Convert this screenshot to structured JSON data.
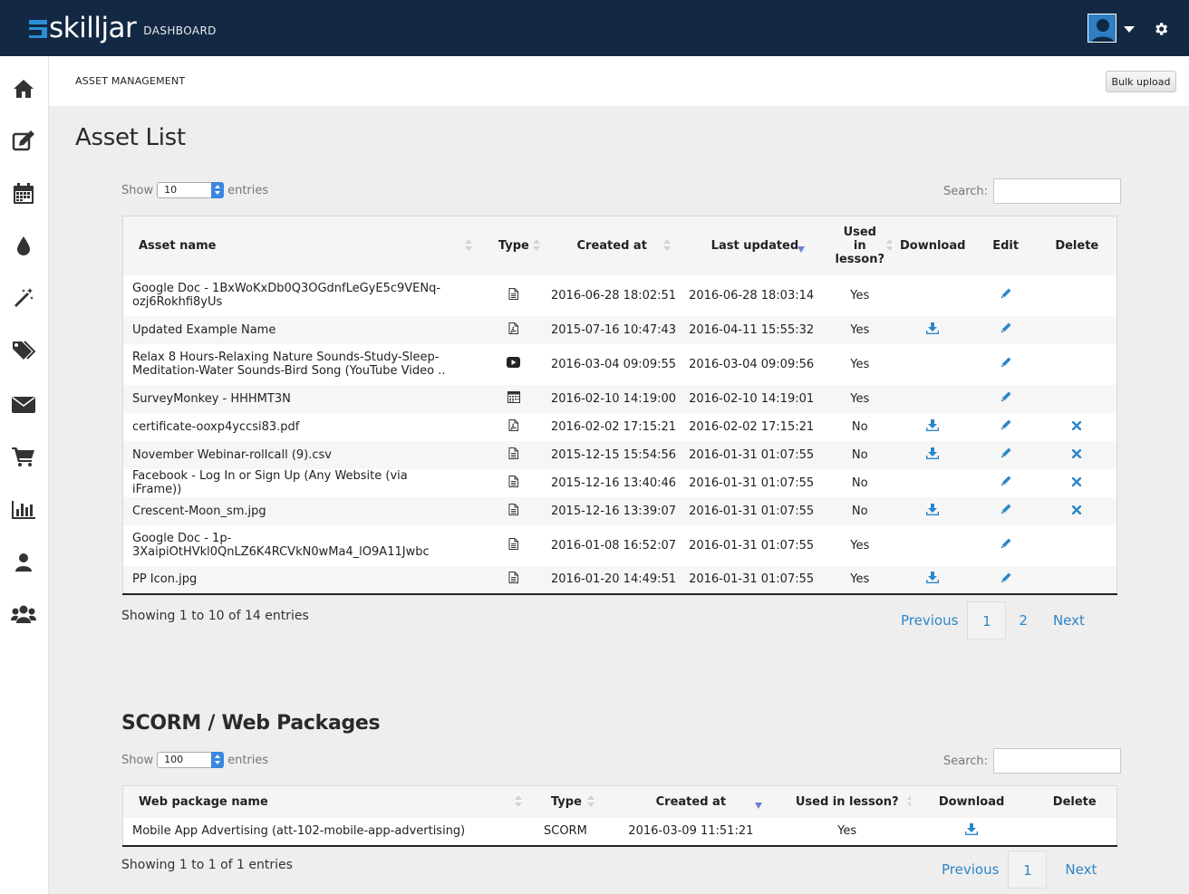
{
  "app": {
    "logo_text": "skilljar",
    "logo_sub": "DASHBOARD"
  },
  "sidebar": {
    "items": [
      {
        "icon": "home-icon"
      },
      {
        "icon": "edit-icon"
      },
      {
        "icon": "calendar-icon"
      },
      {
        "icon": "drop-icon"
      },
      {
        "icon": "magic-wand-icon"
      },
      {
        "icon": "tags-icon"
      },
      {
        "icon": "envelope-icon"
      },
      {
        "icon": "cart-icon"
      },
      {
        "icon": "bar-chart-icon"
      },
      {
        "icon": "user-icon"
      },
      {
        "icon": "group-icon"
      }
    ]
  },
  "header": {
    "breadcrumb": "ASSET MANAGEMENT",
    "bulk_upload": "Bulk upload"
  },
  "asset_list": {
    "title": "Asset List",
    "show_label": "Show",
    "entries_label": "entries",
    "page_length": "10",
    "search_label": "Search:",
    "columns": {
      "name": "Asset name",
      "type": "Type",
      "created": "Created at",
      "updated": "Last updated",
      "used_line1": "Used",
      "used_line2": "in",
      "used_line3": "lesson?",
      "download": "Download",
      "edit": "Edit",
      "delete": "Delete"
    },
    "rows": [
      {
        "name": "Google Doc - 1BxWoKxDb0Q3OGdnfLeGyE5c9VENq-ozj6Rokhfi8yUs",
        "type_icon": "doc-icon",
        "created": "2016-06-28 18:02:51",
        "updated": "2016-06-28 18:03:14",
        "used": "Yes",
        "download": false,
        "delete": false
      },
      {
        "name": "Updated Example Name",
        "type_icon": "pdf-icon",
        "created": "2015-07-16 10:47:43",
        "updated": "2016-04-11 15:55:32",
        "used": "Yes",
        "download": true,
        "delete": false
      },
      {
        "name": "Relax 8 Hours-Relaxing Nature Sounds-Study-Sleep-Meditation-Water Sounds-Bird Song (YouTube Video ..",
        "type_icon": "youtube-icon",
        "created": "2016-03-04 09:09:55",
        "updated": "2016-03-04 09:09:56",
        "used": "Yes",
        "download": false,
        "delete": false
      },
      {
        "name": "SurveyMonkey - HHHMT3N",
        "type_icon": "survey-icon",
        "created": "2016-02-10 14:19:00",
        "updated": "2016-02-10 14:19:01",
        "used": "Yes",
        "download": false,
        "delete": false
      },
      {
        "name": "certificate-ooxp4yccsi83.pdf",
        "type_icon": "pdf-icon",
        "created": "2016-02-02 17:15:21",
        "updated": "2016-02-02 17:15:21",
        "used": "No",
        "download": true,
        "delete": true
      },
      {
        "name": "November Webinar-rollcall (9).csv",
        "type_icon": "doc-icon",
        "created": "2015-12-15 15:54:56",
        "updated": "2016-01-31 01:07:55",
        "used": "No",
        "download": true,
        "delete": true
      },
      {
        "name": "Facebook - Log In or Sign Up (Any Website (via iFrame))",
        "type_icon": "doc-icon",
        "created": "2015-12-16 13:40:46",
        "updated": "2016-01-31 01:07:55",
        "used": "No",
        "download": false,
        "delete": true
      },
      {
        "name": "Crescent-Moon_sm.jpg",
        "type_icon": "doc-icon",
        "created": "2015-12-16 13:39:07",
        "updated": "2016-01-31 01:07:55",
        "used": "No",
        "download": true,
        "delete": true
      },
      {
        "name": "Google Doc - 1p-3XaipiOtHVkl0QnLZ6K4RCVkN0wMa4_lO9A11Jwbc",
        "type_icon": "doc-icon",
        "created": "2016-01-08 16:52:07",
        "updated": "2016-01-31 01:07:55",
        "used": "Yes",
        "download": false,
        "delete": false
      },
      {
        "name": "PP Icon.jpg",
        "type_icon": "doc-icon",
        "created": "2016-01-20 14:49:51",
        "updated": "2016-01-31 01:07:55",
        "used": "Yes",
        "download": true,
        "delete": false
      }
    ],
    "showing": "Showing 1 to 10 of 14 entries",
    "pager": {
      "previous": "Previous",
      "pages": [
        "1",
        "2"
      ],
      "next": "Next"
    }
  },
  "scorm": {
    "title": "SCORM / Web Packages",
    "show_label": "Show",
    "entries_label": "entries",
    "page_length": "100",
    "search_label": "Search:",
    "columns": {
      "name": "Web package name",
      "type": "Type",
      "created": "Created at",
      "used": "Used in lesson?",
      "download": "Download",
      "delete": "Delete"
    },
    "rows": [
      {
        "name": "Mobile App Advertising (att-102-mobile-app-advertising)",
        "type": "SCORM",
        "created": "2016-03-09 11:51:21",
        "used": "Yes",
        "download": true
      }
    ],
    "showing": "Showing 1 to 1 of 1 entries",
    "pager": {
      "previous": "Previous",
      "pages": [
        "1"
      ],
      "next": "Next"
    }
  },
  "colors": {
    "topbar": "#132842",
    "accent": "#2c86c8",
    "logo_blue": "#2a8fd8",
    "sidebar_icon": "#333333"
  }
}
